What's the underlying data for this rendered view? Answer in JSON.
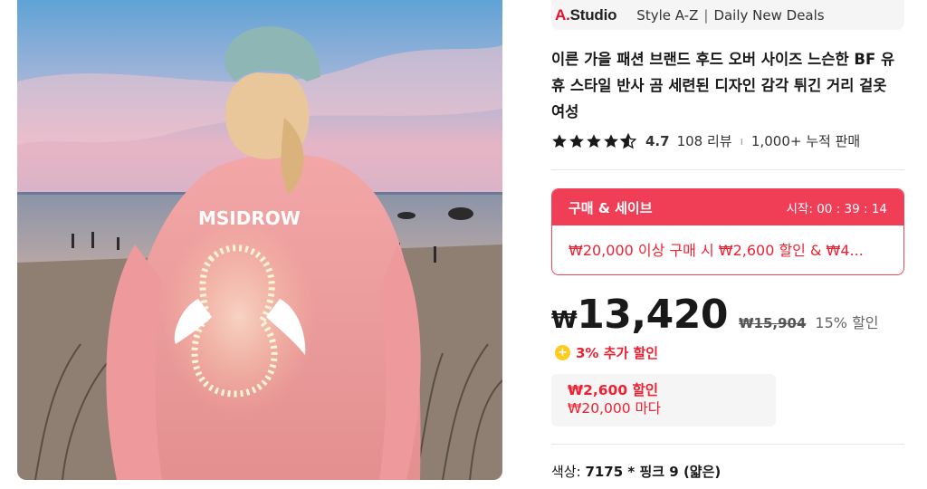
{
  "image": {
    "alt_icon": "product-photo",
    "print_text": "MSIDROW"
  },
  "store": {
    "logo_prefix": "A.",
    "logo_suffix": "Studio",
    "link_style": "Style A-Z",
    "separator": "|",
    "link_deals": "Daily New Deals",
    "accent": "#e8112d"
  },
  "product": {
    "title": "이른 가을 패션 브랜드 후드 오버 사이즈 느슨한 BF 유휴 스타일 반사 곰 세련된 디자인 감각 튀긴 거리 겉옷 여성",
    "rating": "4.7",
    "stars_filled": 4.5,
    "reviews": "108 리뷰",
    "rating_separator": "ı",
    "sold": "1,000+ 누적 판매"
  },
  "promo": {
    "title": "구매 & 세이브",
    "timer": "시작: 00 : 39 : 14",
    "text": "₩20,000 이상 구매 시 ₩2,600 할인 & ₩4...",
    "color": "#f03e57"
  },
  "price": {
    "currency": "₩",
    "amount": "13,420",
    "original": "₩15,904",
    "discount": "15% 할인"
  },
  "extra": {
    "icon": "coin-icon",
    "icon_glyph": "+",
    "text": "3% 추가 할인"
  },
  "coupon": {
    "line1": "₩2,600 할인",
    "line2": "₩20,000 마다"
  },
  "variant": {
    "label": "색상:",
    "value": "7175 * 핑크 9 (얇은)"
  }
}
